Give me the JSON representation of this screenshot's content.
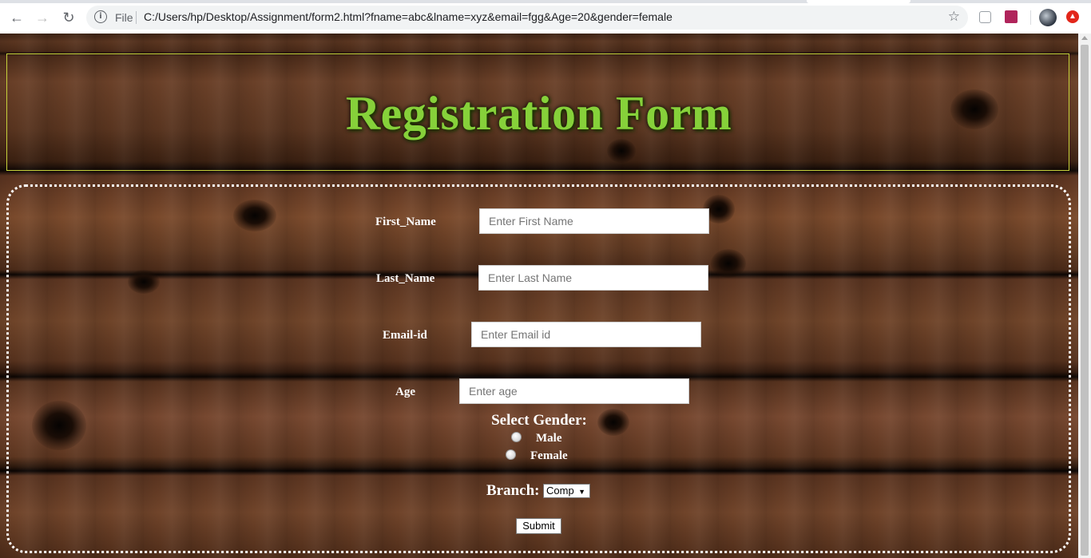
{
  "browser": {
    "url_scheme": "File",
    "url": "C:/Users/hp/Desktop/Assignment/form2.html?fname=abc&lname=xyz&email=fgg&Age=20&gender=female"
  },
  "header": {
    "title": "Registration Form",
    "title_color": "#86d13a",
    "border_color": "#c7d23c"
  },
  "form": {
    "fields": [
      {
        "label": "First_Name",
        "placeholder": "Enter First Name"
      },
      {
        "label": "Last_Name",
        "placeholder": "Enter Last Name"
      },
      {
        "label": "Email-id",
        "placeholder": "Enter Email id"
      },
      {
        "label": "Age",
        "placeholder": "Enter age"
      }
    ],
    "gender": {
      "title": "Select Gender:",
      "options": [
        "Male",
        "Female"
      ]
    },
    "branch": {
      "label": "Branch:",
      "selected": "Comp"
    },
    "submit_label": "Submit"
  }
}
